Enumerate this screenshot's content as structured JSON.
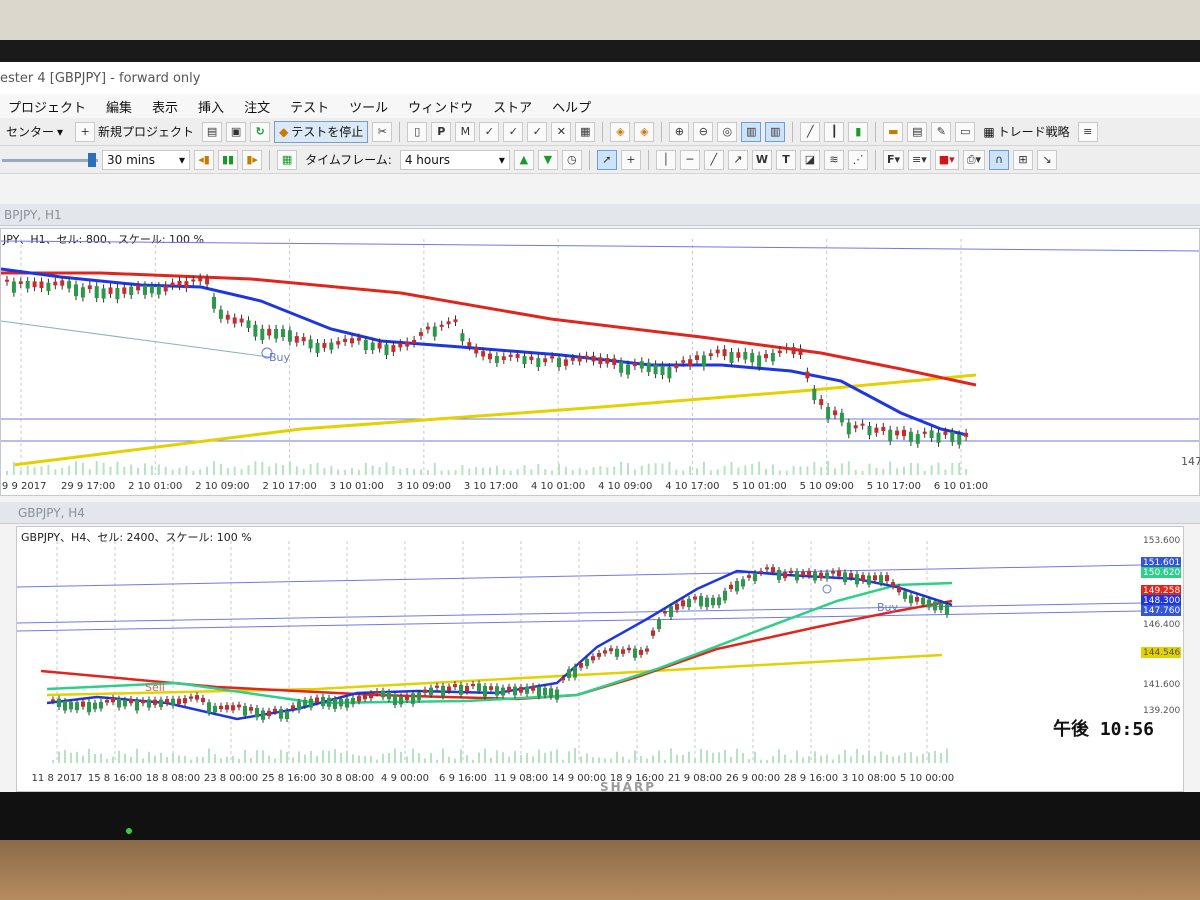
{
  "window": {
    "title": "ester 4  [GBPJPY] - forward only"
  },
  "menu": [
    "プロジェクト",
    "編集",
    "表示",
    "挿入",
    "注文",
    "テスト",
    "ツール",
    "ウィンドウ",
    "ストア",
    "ヘルプ"
  ],
  "toolbar1": {
    "center_label": "センター",
    "new_project_label": "新規プロジェクト",
    "stop_test_label": "テストを停止",
    "trade_strategy_label": "トレード戦略"
  },
  "toolbar2": {
    "speed_value": "30 mins",
    "timeframe_label": "タイムフレーム:",
    "timeframe_value": "4 hours"
  },
  "colors": {
    "ma_red": "#e0261c",
    "ma_blue": "#1d36e0",
    "ma_yellow": "#e3d100",
    "ma_teal": "#2fcf8a",
    "hline": "#6f78e8",
    "grid": "#c9c9c9"
  },
  "panel1": {
    "header": "BPJPY, H1",
    "info": "JPY、H1、セル: 800、スケール: 100 %",
    "buy_label": "Buy",
    "price_labels": [
      "147"
    ],
    "x_labels": [
      "29 9 2017",
      "29 9 17:00",
      "2 10 01:00",
      "2 10 09:00",
      "2 10 17:00",
      "3 10 01:00",
      "3 10 09:00",
      "3 10 17:00",
      "4 10 01:00",
      "4 10 09:00",
      "4 10 17:00",
      "5 10 01:00",
      "5 10 09:00",
      "5 10 17:00",
      "6 10 01:00"
    ]
  },
  "panel2": {
    "header": "GBPJPY, H4",
    "info": "GBPJPY、H4、セル: 2400、スケール: 100 %",
    "buy_label": "Buy",
    "sell_label": "Sell",
    "y_labels": [
      "153.600",
      "151.601",
      "150.620",
      "149.258",
      "148.300",
      "147.760",
      "146.400",
      "144.546",
      "141.600",
      "139.200"
    ],
    "x_labels": [
      "11 8 2017",
      "15 8 16:00",
      "18 8 08:00",
      "23 8 00:00",
      "25 8 16:00",
      "30 8 08:00",
      "4 9 00:00",
      "6 9 16:00",
      "11 9 08:00",
      "14 9 00:00",
      "18 9 16:00",
      "21 9 08:00",
      "26 9 00:00",
      "28 9 16:00",
      "3 10 08:00",
      "5 10 00:00"
    ]
  },
  "clock": "午後 10:56",
  "bezel": {
    "brand": "SHARP"
  }
}
